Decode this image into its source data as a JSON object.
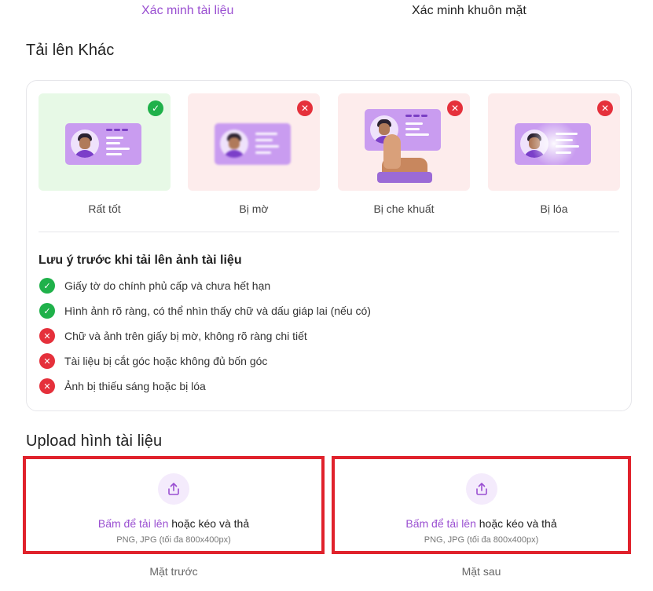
{
  "tabs": {
    "document": "Xác minh tài liệu",
    "face": "Xác minh khuôn mặt"
  },
  "section_other": {
    "title": "Tải lên Khác"
  },
  "samples": [
    {
      "label": "Rất tốt",
      "status": "ok"
    },
    {
      "label": "Bị mờ",
      "status": "bad"
    },
    {
      "label": "Bị che khuất",
      "status": "bad"
    },
    {
      "label": "Bị lóa",
      "status": "bad"
    }
  ],
  "notes": {
    "title": "Lưu ý trước khi tải lên ảnh tài liệu",
    "items": [
      {
        "text": "Giấy tờ do chính phủ cấp và chưa hết hạn",
        "status": "ok"
      },
      {
        "text": "Hình ảnh rõ ràng, có thể nhìn thấy chữ và dấu giáp lai (nếu có)",
        "status": "ok"
      },
      {
        "text": "Chữ và ảnh trên giấy bị mờ, không rõ ràng chi tiết",
        "status": "bad"
      },
      {
        "text": "Tài liệu bị cắt góc hoặc không đủ bốn góc",
        "status": "bad"
      },
      {
        "text": "Ảnh bị thiếu sáng hoặc bị lóa",
        "status": "bad"
      }
    ]
  },
  "upload": {
    "title": "Upload hình tài liệu",
    "link_text": "Bấm để tải lên",
    "drag_text": " hoặc kéo và thả",
    "hint": "PNG, JPG (tối đa 800x400px)",
    "front_caption": "Mặt trước",
    "back_caption": "Mặt sau"
  },
  "colors": {
    "accent": "#9a4fd1",
    "ok": "#1fb14a",
    "error": "#e5303b",
    "highlight_border": "#e0222c"
  },
  "icons": {
    "ok": "check-icon",
    "bad": "x-icon",
    "upload": "upload-icon"
  }
}
